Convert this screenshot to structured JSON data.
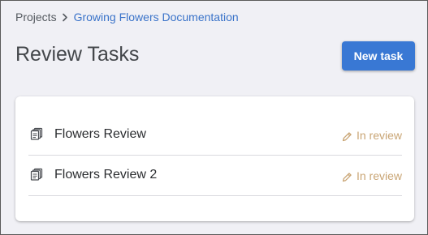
{
  "breadcrumb": {
    "root": "Projects",
    "current": "Growing Flowers Documentation"
  },
  "header": {
    "title": "Review Tasks",
    "new_task_label": "New task"
  },
  "tasks": [
    {
      "name": "Flowers Review",
      "status": "In review",
      "icon": "documents-stack-icon",
      "status_icon": "pencil-icon"
    },
    {
      "name": "Flowers Review 2",
      "status": "In review",
      "icon": "documents-stack-icon",
      "status_icon": "pencil-icon"
    }
  ],
  "colors": {
    "accent": "#3978d4",
    "breadcrumb_link": "#3a73c9",
    "status_in_review": "#c9a574",
    "page_background": "#f0f0f5"
  }
}
